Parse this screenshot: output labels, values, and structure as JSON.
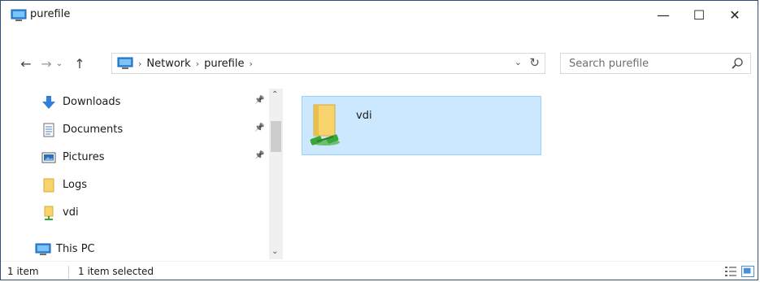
{
  "window": {
    "title": "purefile",
    "minimize_glyph": "—",
    "maximize_glyph": "☐",
    "close_glyph": "✕"
  },
  "nav": {
    "back_glyph": "←",
    "forward_glyph": "→",
    "recent_glyph": "⌄",
    "up_glyph": "↑"
  },
  "address": {
    "crumbs": [
      "Network",
      "purefile"
    ],
    "sep_glyph": "›",
    "dropdown_glyph": "⌄",
    "refresh_glyph": "↻"
  },
  "search": {
    "placeholder": "Search purefile"
  },
  "navpane": {
    "items": [
      {
        "label": "Downloads",
        "icon": "download-icon",
        "pinned": true
      },
      {
        "label": "Documents",
        "icon": "documents-icon",
        "pinned": true
      },
      {
        "label": "Pictures",
        "icon": "pictures-icon",
        "pinned": true
      },
      {
        "label": "Logs",
        "icon": "folder-icon",
        "pinned": false
      },
      {
        "label": "vdi",
        "icon": "network-folder-icon",
        "pinned": false
      },
      {
        "label": "This PC",
        "icon": "this-pc-icon",
        "pinned": false
      }
    ],
    "pin_glyph": "📌",
    "scroll_up": "⌃",
    "scroll_down": "⌄"
  },
  "content": {
    "items": [
      {
        "name": "vdi",
        "icon": "network-share-folder-icon",
        "selected": true
      }
    ]
  },
  "status": {
    "count": "1 item",
    "selected": "1 item selected"
  },
  "colors": {
    "selection_fill": "#cce8ff",
    "selection_border": "#99d1ff",
    "window_border": "#2b4f7a"
  }
}
